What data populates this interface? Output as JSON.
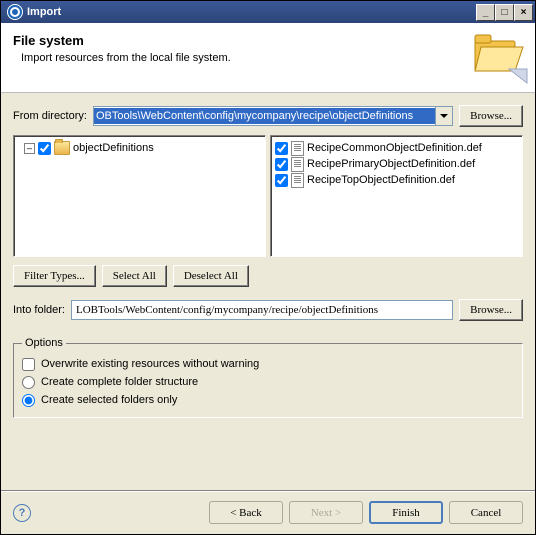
{
  "window": {
    "title": "Import"
  },
  "banner": {
    "heading": "File system",
    "subtext": "Import resources from the local file system."
  },
  "fromDirectory": {
    "label": "From directory:",
    "value": "OBTools\\WebContent\\config\\mycompany\\recipe\\objectDefinitions",
    "browse": "Browse..."
  },
  "tree": {
    "root": "objectDefinitions"
  },
  "files": [
    "RecipeCommonObjectDefinition.def",
    "RecipePrimaryObjectDefinition.def",
    "RecipeTopObjectDefinition.def"
  ],
  "buttons": {
    "filterTypes": "Filter Types...",
    "selectAll": "Select All",
    "deselectAll": "Deselect All"
  },
  "intoFolder": {
    "label": "Into folder:",
    "value": "LOBTools/WebContent/config/mycompany/recipe/objectDefinitions",
    "browse": "Browse..."
  },
  "options": {
    "legend": "Options",
    "overwrite": "Overwrite existing resources without warning",
    "complete": "Create complete folder structure",
    "selected": "Create selected folders only"
  },
  "footer": {
    "back": "< Back",
    "next": "Next >",
    "finish": "Finish",
    "cancel": "Cancel"
  }
}
